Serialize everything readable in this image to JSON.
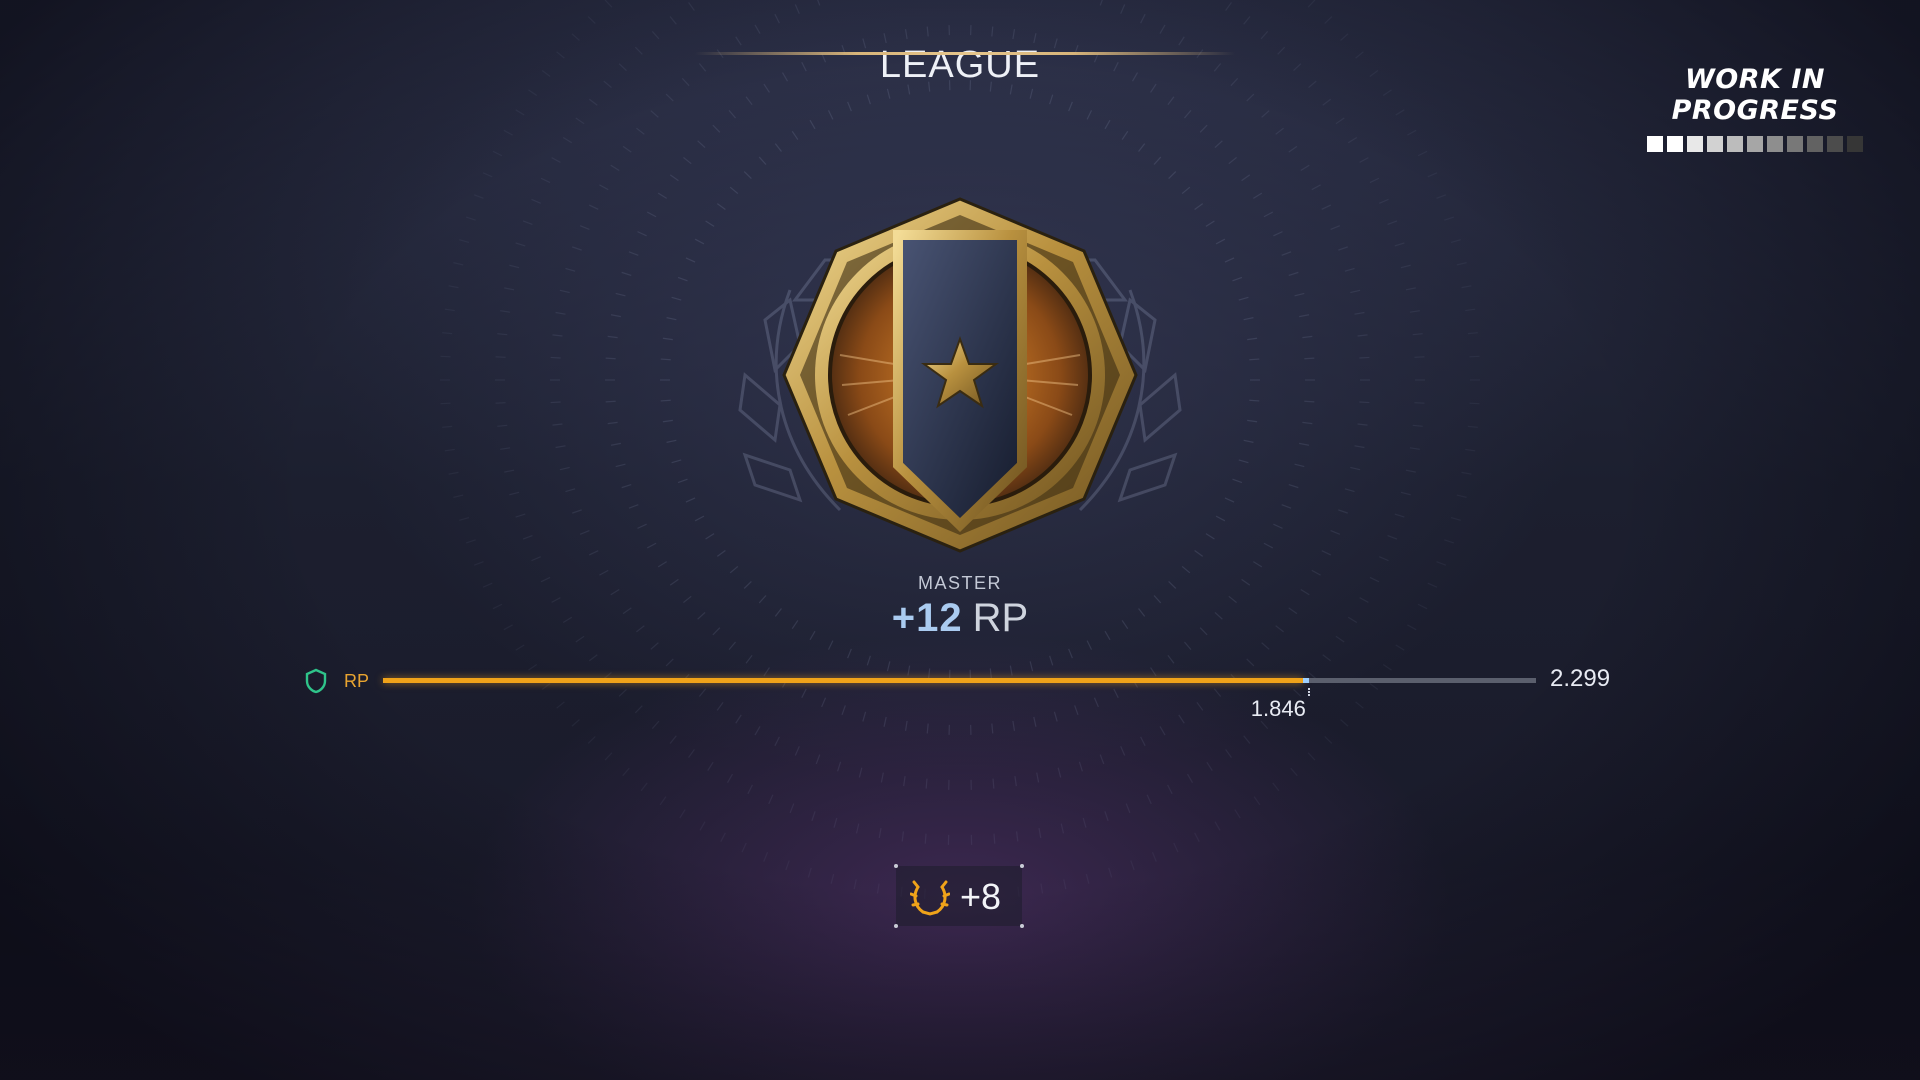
{
  "header": {
    "title": "LEAGUE"
  },
  "wip": {
    "line1": "WORK IN",
    "line2": "PROGRESS",
    "segments": [
      "#ffffff",
      "#ffffff",
      "#e8e8e8",
      "#d2d2d2",
      "#bcbcbc",
      "#a6a6a6",
      "#8e8e8e",
      "#787878",
      "#626262",
      "#4c4c4c",
      "#363636"
    ]
  },
  "rank": {
    "name": "MASTER",
    "gain_number": "+12",
    "gain_unit": "RP"
  },
  "progress": {
    "label": "RP",
    "max_label": "2.299",
    "current_label": "1.846",
    "max": 2299,
    "current": 1846,
    "previous": 1834,
    "accent": "#f0a31a",
    "gain_color": "#9fd0ff"
  },
  "reward": {
    "icon": "laurel-icon",
    "value": "+8",
    "color": "#f0a31a"
  }
}
